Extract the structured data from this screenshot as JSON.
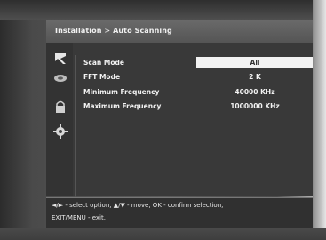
{
  "header": {
    "breadcrumb_parent": "Installation",
    "breadcrumb_sep": ">",
    "breadcrumb_current": "Auto Scanning"
  },
  "side_icons": [
    "satellite-dish-icon",
    "antenna-icon",
    "lock-icon",
    "gear-icon"
  ],
  "settings": [
    {
      "label": "Scan Mode",
      "value": "All",
      "selected": true
    },
    {
      "label": "FFT Mode",
      "value": "2 K"
    },
    {
      "label": "Minimum Frequency",
      "value": "40000 KHz"
    },
    {
      "label": "Maximum Frequency",
      "value": "1000000 KHz"
    }
  ],
  "footer": {
    "line1": "◄/► - select option, ▲/▼ - move, OK - confirm selection,",
    "line2": "EXIT/MENU - exit."
  }
}
